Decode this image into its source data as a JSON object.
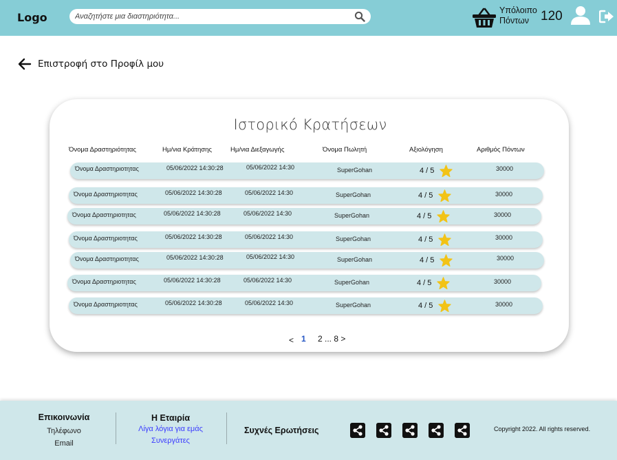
{
  "header": {
    "logo": "Logo",
    "search_placeholder": "Αναζητήστε μια διαστηριότητα...",
    "points_label_line1": "Υπόλοιπο",
    "points_label_line2": "Πόντων",
    "points_value": "120",
    "bg_color": "#86cdd6"
  },
  "back": {
    "label": "Επιστροφή στο Προφίλ μου"
  },
  "history": {
    "title": "Ιστορικό Κρατήσεων",
    "columns": [
      "Όνομα Δραστηριότητας",
      "Ημ/νια Κράτησης",
      "Ημ/νια Διεξαγωγής",
      "Όνομα Πωλητή",
      "Αξιολόγηση",
      "Αριθμός Πόντων"
    ],
    "rows": [
      {
        "activity": "Όνομα Δραστηριοτητας",
        "booked": "05/06/2022 14:30:28",
        "held": "05/06/2022 14:30",
        "seller": "SuperGohan",
        "rating": "4 / 5",
        "points": "30000"
      },
      {
        "activity": "Όνομα Δραστηριοτητας",
        "booked": "05/06/2022 14:30:28",
        "held": "05/06/2022 14:30",
        "seller": "SuperGohan",
        "rating": "4 / 5",
        "points": "30000"
      },
      {
        "activity": "Όνομα Δραστηριοτητας",
        "booked": "05/06/2022 14:30:28",
        "held": "05/06/2022 14:30",
        "seller": "SuperGohan",
        "rating": "4 / 5",
        "points": "30000"
      },
      {
        "activity": "Όνομα Δραστηριοτητας",
        "booked": "05/06/2022 14:30:28",
        "held": "05/06/2022 14:30",
        "seller": "SuperGohan",
        "rating": "4 / 5",
        "points": "30000"
      },
      {
        "activity": "Όνομα Δραστηριοτητας",
        "booked": "05/06/2022 14:30:28",
        "held": "05/06/2022 14:30",
        "seller": "SuperGohan",
        "rating": "4 / 5",
        "points": "30000"
      },
      {
        "activity": "Όνομα Δραστηριοτητας",
        "booked": "05/06/2022 14:30:28",
        "held": "05/06/2022 14:30",
        "seller": "SuperGohan",
        "rating": "4 / 5",
        "points": "30000"
      },
      {
        "activity": "Όνομα Δραστηριοτητας",
        "booked": "05/06/2022 14:30:28",
        "held": "05/06/2022 14:30",
        "seller": "SuperGohan",
        "rating": "4 / 5",
        "points": "30000"
      }
    ],
    "star_color": "#f2c316",
    "row_color": "#cfe7ea"
  },
  "pagination": {
    "prev": "<",
    "current": "1",
    "rest": "2 ... 8 >"
  },
  "footer": {
    "contact_head": "Επικοινωνία",
    "contact_items": [
      "Τηλέφωνο",
      "Email"
    ],
    "company_head": "Η Εταιρία",
    "company_links": [
      "Λίγα λόγια για εμάς",
      "Συνεργάτες"
    ],
    "faq": "Συχνές Ερωτήσεις",
    "share_icons": [
      "share-icon",
      "share-icon",
      "share-icon",
      "share-icon",
      "share-icon"
    ],
    "copyright": "Copyright 2022. All rights reserved.",
    "bg_color": "#cfe7ea",
    "link_color": "#3a3aff"
  }
}
